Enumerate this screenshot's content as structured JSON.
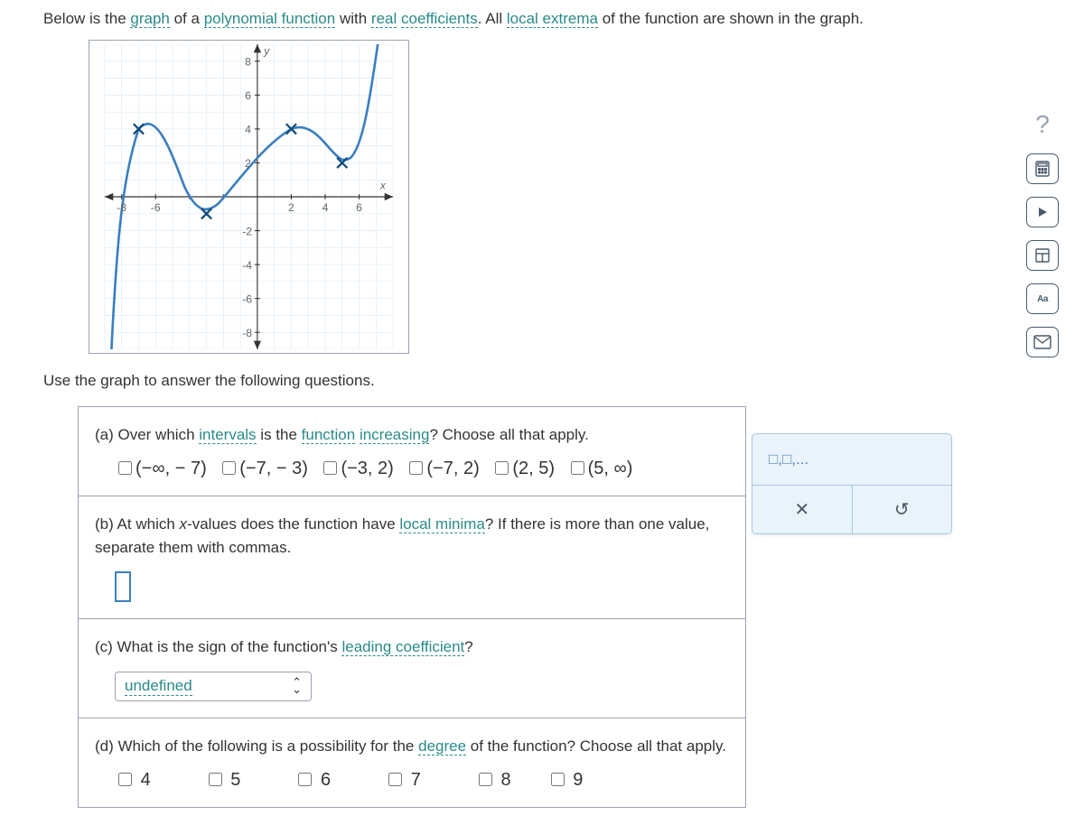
{
  "intro": {
    "t1": "Below is the ",
    "link1": "graph",
    "t2": " of a ",
    "link2": "polynomial function",
    "t3": " with ",
    "link3": "real",
    "t3b": " ",
    "link4": "coefficients",
    "t4": ". All ",
    "link5": "local extrema",
    "t5": " of the function are shown in the graph."
  },
  "follow": "Use the graph to answer the following questions.",
  "a": {
    "t1": "(a) Over which ",
    "link1": "intervals",
    "t2": " is the ",
    "link2": "function",
    "t2b": " ",
    "link3": "increasing",
    "t3": "? Choose all that apply.",
    "opts": [
      "(−∞, − 7)",
      "(−7, − 3)",
      "(−3, 2)",
      "(−7, 2)",
      "(2, 5)",
      "(5, ∞)"
    ]
  },
  "b": {
    "t1": "(b) At which ",
    "xvar": "x",
    "t2": "-values does the function have ",
    "link1": "local minima",
    "t3": "? If there is more than one value, separate them with commas."
  },
  "c": {
    "t1": "(c) What is the sign of the function's ",
    "link1": "leading coefficient",
    "t2": "?",
    "selected": "undefined"
  },
  "d": {
    "t1": "(d) Which of the following is a possibility for the ",
    "link1": "degree",
    "t2": " of the function? Choose all that apply.",
    "opts": [
      "4",
      "5",
      "6",
      "7",
      "8",
      "9"
    ]
  },
  "panel": {
    "hint": "□,□,...",
    "close": "✕",
    "undo": "↺"
  },
  "rail": {
    "q": "?",
    "calc": "🖩",
    "play": "▶",
    "table": "⊞",
    "aa": "Aa",
    "mail": "✉"
  },
  "chart_data": {
    "type": "line",
    "xlabel": "x",
    "ylabel": "y",
    "xlim": [
      -9,
      8
    ],
    "ylim": [
      -9,
      9
    ],
    "xticks": [
      -8,
      -6,
      -4,
      -2,
      2,
      4,
      6
    ],
    "yticks": [
      -8,
      -6,
      -4,
      -2,
      2,
      4,
      6,
      8
    ],
    "extrema": [
      {
        "x": -7,
        "y": 4,
        "type": "max"
      },
      {
        "x": -3,
        "y": -1,
        "type": "min"
      },
      {
        "x": 2,
        "y": 4,
        "type": "max"
      },
      {
        "x": 5,
        "y": 2,
        "type": "min"
      }
    ],
    "curve_notes": "Polynomial rising from bottom-left, local max at (-7,4), local min at (-3,-1), local max at (2,4), local min at (5,2), then rising steeply through top edge near x≈7."
  }
}
